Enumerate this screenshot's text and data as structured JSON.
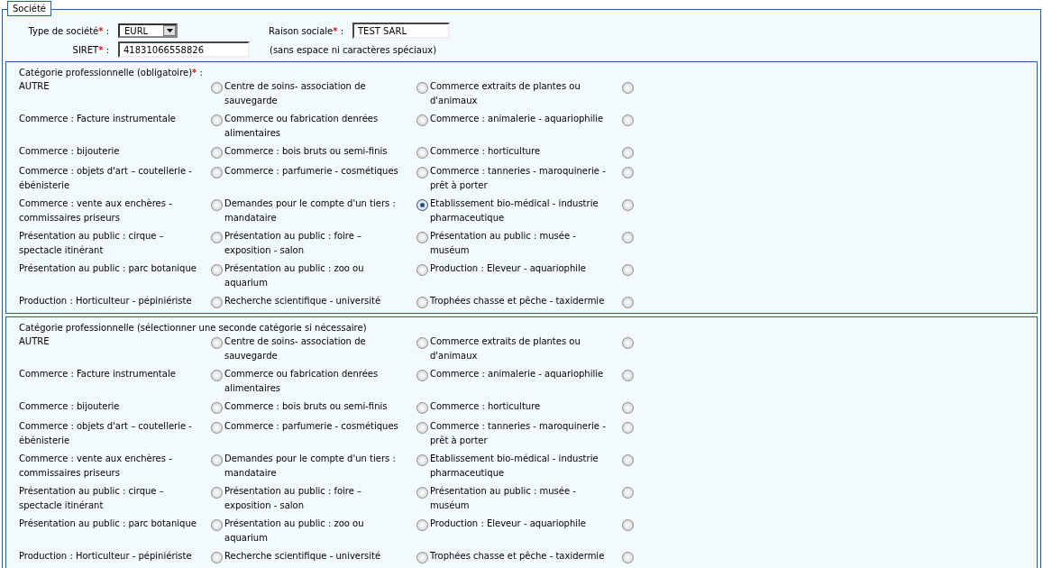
{
  "legend": "Société",
  "fields": [
    {
      "label": "Type de société",
      "required_mark": "*",
      "colon": ":",
      "kind": "select",
      "value": "EURL"
    },
    {
      "label": "Raison sociale",
      "required_mark": "*",
      "colon": ":",
      "kind": "text",
      "value": "TEST SARL"
    },
    {
      "label": "SIRET",
      "required_mark": "*",
      "colon": ":",
      "kind": "text",
      "value": "41831066558826",
      "note": "(sans espace ni caractères spéciaux)"
    }
  ],
  "sections": [
    {
      "title": "Catégorie professionnelle (obligatoire)",
      "required_mark": "*",
      "colon": ":",
      "options": [
        {
          "label": "AUTRE",
          "selected": false
        },
        {
          "label": "Centre de soins- association de sauvegarde",
          "selected": false
        },
        {
          "label": "Commerce extraits de plantes ou d'animaux",
          "selected": false
        },
        {
          "label": "Commerce : Facture instrumentale",
          "selected": false
        },
        {
          "label": "Commerce ou fabrication denrées alimentaires",
          "selected": false
        },
        {
          "label": "Commerce : animalerie - aquariophilie",
          "selected": false
        },
        {
          "label": "Commerce : bijouterie",
          "selected": false
        },
        {
          "label": "Commerce : bois bruts ou semi-finis",
          "selected": false
        },
        {
          "label": "Commerce : horticulture",
          "selected": false
        },
        {
          "label": "Commerce : objets d'art – coutellerie - ébénisterie",
          "selected": false
        },
        {
          "label": "Commerce : parfumerie - cosmétiques",
          "selected": false
        },
        {
          "label": "Commerce : tanneries - maroquinerie - prêt à porter",
          "selected": false
        },
        {
          "label": "Commerce : vente aux enchères - commissaires priseurs",
          "selected": false
        },
        {
          "label": "Demandes pour le compte d'un tiers : mandataire",
          "selected": true
        },
        {
          "label": "Etablissement bio-médical - industrie pharmaceutique",
          "selected": false
        },
        {
          "label": "Présentation au public : cirque – spectacle itinérant",
          "selected": false
        },
        {
          "label": "Présentation au public : foire – exposition - salon",
          "selected": false
        },
        {
          "label": "Présentation au public : musée - muséum",
          "selected": false
        },
        {
          "label": "Présentation au public : parc botanique",
          "selected": false
        },
        {
          "label": "Présentation au public : zoo ou aquarium",
          "selected": false
        },
        {
          "label": "Production : Eleveur - aquariophile",
          "selected": false
        },
        {
          "label": "Production : Horticulteur - pépiniériste",
          "selected": false
        },
        {
          "label": "Recherche scientifique - université",
          "selected": false
        },
        {
          "label": "Trophées chasse et pêche - taxidermie",
          "selected": false
        }
      ]
    },
    {
      "title": "Catégorie professionnelle (sélectionner une seconde catégorie si nécessaire)",
      "options": [
        {
          "label": "AUTRE",
          "selected": false
        },
        {
          "label": "Centre de soins- association de sauvegarde",
          "selected": false
        },
        {
          "label": "Commerce extraits de plantes ou d'animaux",
          "selected": false
        },
        {
          "label": "Commerce : Facture instrumentale",
          "selected": false
        },
        {
          "label": "Commerce ou fabrication denrées alimentaires",
          "selected": false
        },
        {
          "label": "Commerce : animalerie - aquariophilie",
          "selected": false
        },
        {
          "label": "Commerce : bijouterie",
          "selected": false
        },
        {
          "label": "Commerce : bois bruts ou semi-finis",
          "selected": false
        },
        {
          "label": "Commerce : horticulture",
          "selected": false
        },
        {
          "label": "Commerce : objets d'art – coutellerie - ébénisterie",
          "selected": false
        },
        {
          "label": "Commerce : parfumerie - cosmétiques",
          "selected": false
        },
        {
          "label": "Commerce : tanneries - maroquinerie - prêt à porter",
          "selected": false
        },
        {
          "label": "Commerce : vente aux enchères - commissaires priseurs",
          "selected": false
        },
        {
          "label": "Demandes pour le compte d'un tiers : mandataire",
          "selected": false
        },
        {
          "label": "Etablissement bio-médical - industrie pharmaceutique",
          "selected": false
        },
        {
          "label": "Présentation au public : cirque – spectacle itinérant",
          "selected": false
        },
        {
          "label": "Présentation au public : foire – exposition - salon",
          "selected": false
        },
        {
          "label": "Présentation au public : musée - muséum",
          "selected": false
        },
        {
          "label": "Présentation au public : parc botanique",
          "selected": false
        },
        {
          "label": "Présentation au public : zoo ou aquarium",
          "selected": false
        },
        {
          "label": "Production : Eleveur - aquariophile",
          "selected": false
        },
        {
          "label": "Production : Horticulteur - pépiniériste",
          "selected": false
        },
        {
          "label": "Recherche scientifique - université",
          "selected": false
        },
        {
          "label": "Trophées chasse et pêche - taxidermie",
          "selected": false
        }
      ]
    }
  ]
}
